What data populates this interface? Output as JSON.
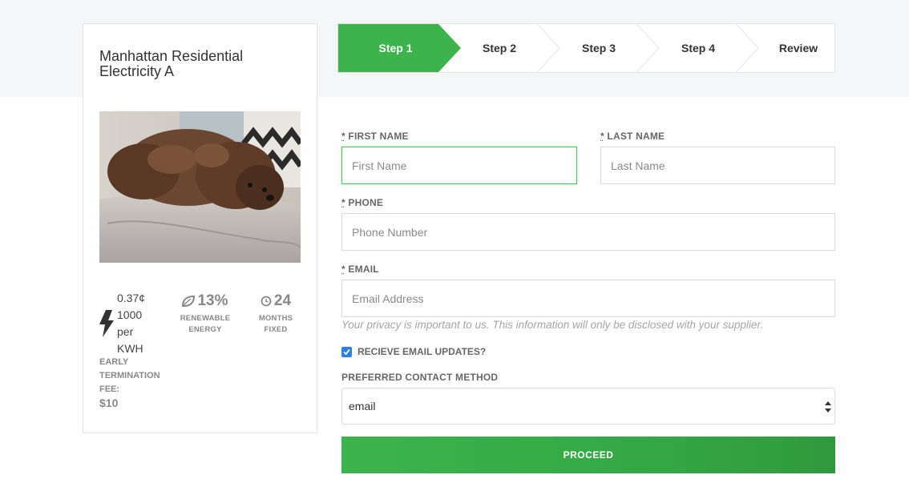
{
  "plan": {
    "title": "Manhattan Residential Electricity A",
    "price_line1": "0.37¢",
    "price_line2": "1000",
    "price_line3": "per",
    "price_line4": "KWH",
    "etf_label_1": "EARLY",
    "etf_label_2": "TERMINATION",
    "etf_label_3": "FEE:",
    "etf_value": "$10",
    "renewable_value": "13%",
    "renewable_label_1": "RENEWABLE",
    "renewable_label_2": "ENERGY",
    "months_value": "24",
    "months_label_1": "MONTHS",
    "months_label_2": "FIXED"
  },
  "steps": [
    {
      "label": "Step 1",
      "active": true
    },
    {
      "label": "Step 2",
      "active": false
    },
    {
      "label": "Step 3",
      "active": false
    },
    {
      "label": "Step 4",
      "active": false
    },
    {
      "label": "Review",
      "active": false
    }
  ],
  "form": {
    "required_mark": "*",
    "first_name_label": "FIRST NAME",
    "first_name_placeholder": "First Name",
    "last_name_label": "LAST NAME",
    "last_name_placeholder": "Last Name",
    "phone_label": "PHONE",
    "phone_placeholder": "Phone Number",
    "email_label": "EMAIL",
    "email_placeholder": "Email Address",
    "privacy_note": "Your privacy is important to us. This information will only be disclosed with your supplier.",
    "email_updates_label": "RECIEVE EMAIL UPDATES?",
    "email_updates_checked": true,
    "contact_method_label": "PREFERRED CONTACT METHOD",
    "contact_method_value": "email",
    "proceed_label": "PROCEED"
  },
  "colors": {
    "accent_green": "#3cb44b",
    "checkbox_blue": "#2d7fe6"
  },
  "icons": {
    "price": "lightning-bolt-icon",
    "renewable": "leaf-icon",
    "months": "clock-icon"
  }
}
